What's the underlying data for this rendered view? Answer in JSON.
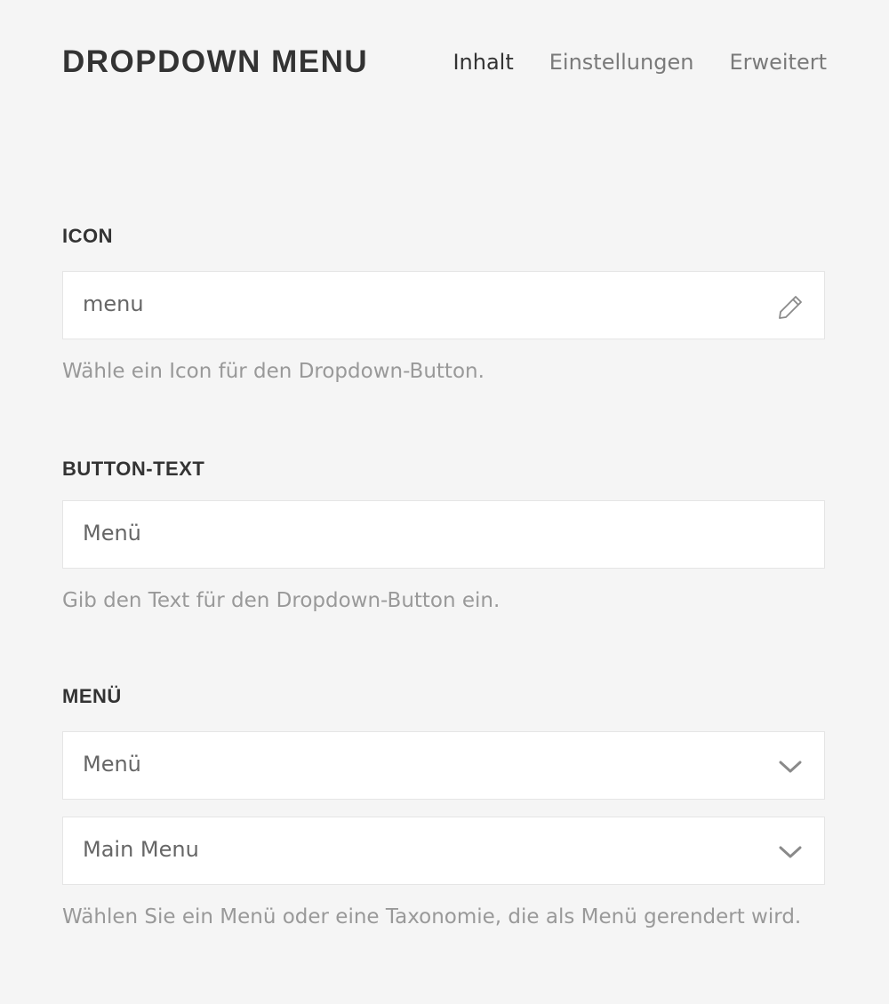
{
  "header": {
    "title": "DROPDOWN MENU",
    "tabs": [
      {
        "label": "Inhalt",
        "active": true
      },
      {
        "label": "Einstellungen",
        "active": false
      },
      {
        "label": "Erweitert",
        "active": false
      }
    ]
  },
  "fields": {
    "icon": {
      "label": "ICON",
      "value": "menu",
      "help": "Wähle ein Icon für den Dropdown-Button.",
      "trailing_icon": "pencil-icon"
    },
    "button_text": {
      "label": "BUTTON-TEXT",
      "value": "Menü",
      "help": "Gib den Text für den Dropdown-Button ein."
    },
    "menu": {
      "label": "MENÜ",
      "select_type": "Menü",
      "select_menu": "Main Menu",
      "help": "Wählen Sie ein Menü oder eine Taxonomie, die als Menü gerendert wird.",
      "trailing_icon": "chevron-down-icon"
    }
  },
  "colors": {
    "background": "#f5f5f5",
    "text_primary": "#333333",
    "text_muted": "#999999",
    "border": "#e5e5e5"
  }
}
